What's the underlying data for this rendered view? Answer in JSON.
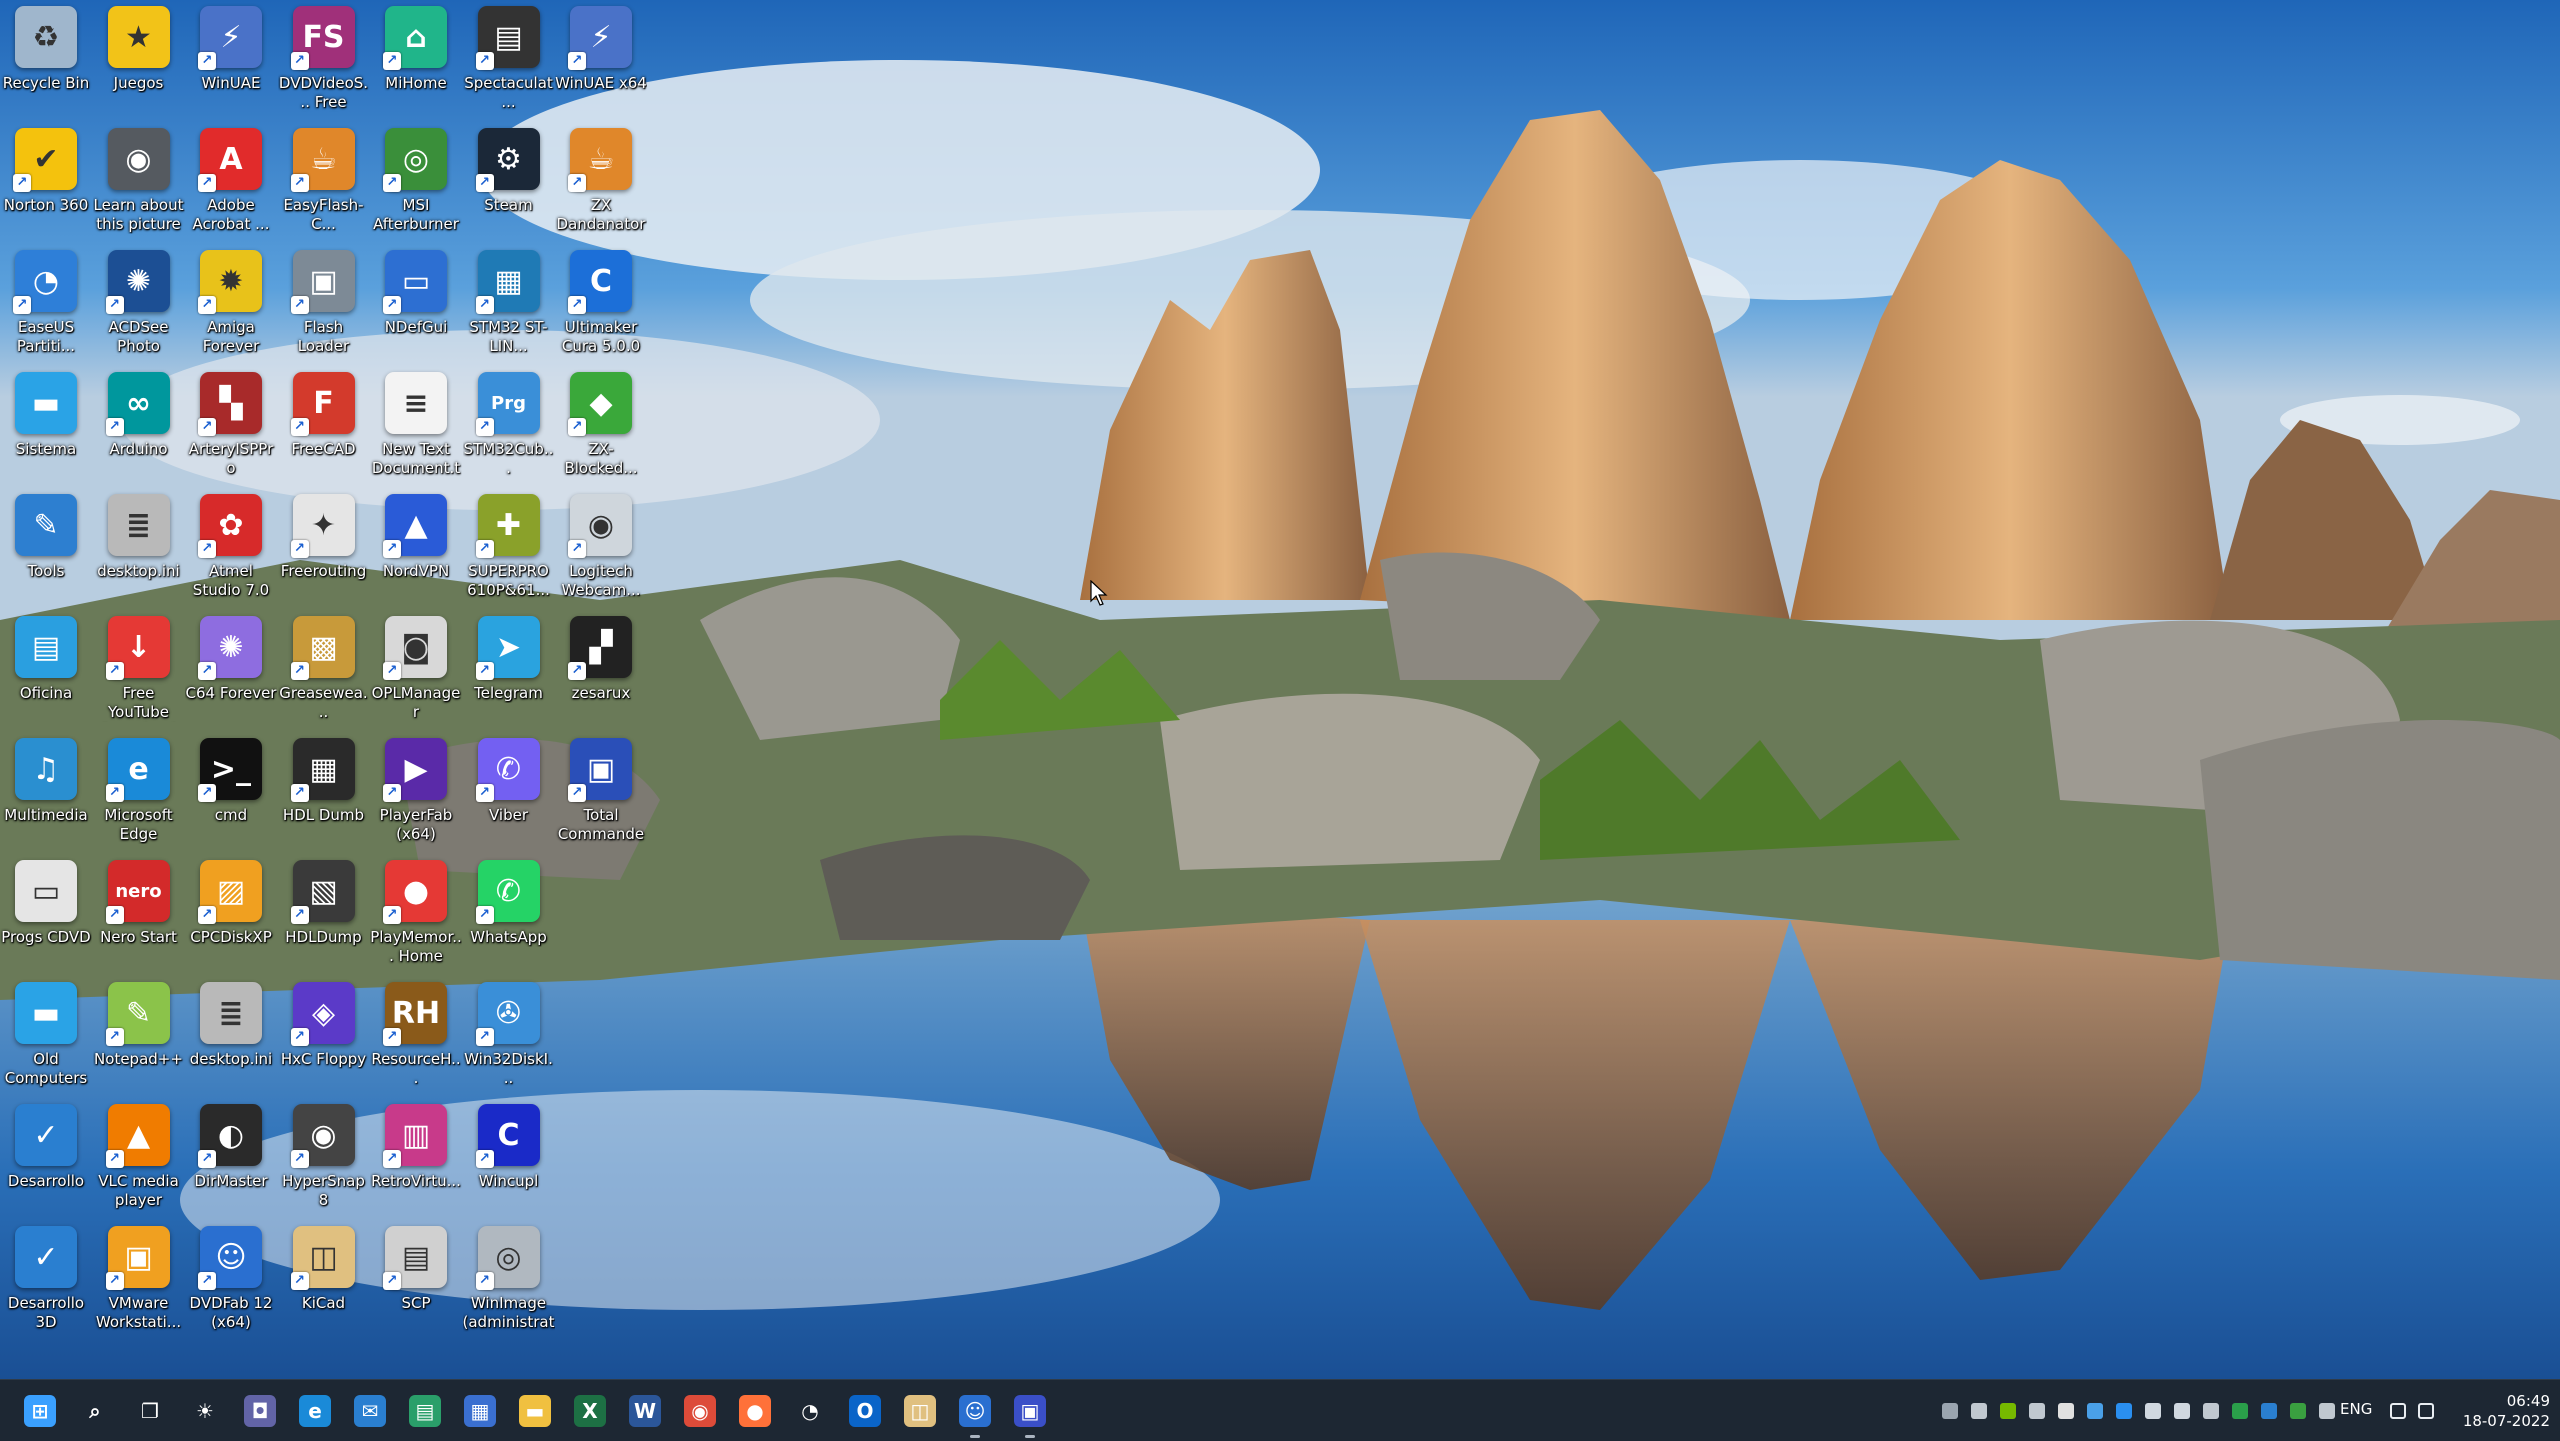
{
  "desktop": {
    "icons": [
      {
        "label": "Recycle Bin",
        "glyph": "recycle-bin-icon",
        "color": "#9fb6cc",
        "sym": "♻",
        "shortcut": false
      },
      {
        "label": "Juegos",
        "glyph": "star-folder-icon",
        "color": "#f2c318",
        "sym": "★",
        "shortcut": false
      },
      {
        "label": "WinUAE",
        "glyph": "winuae-icon",
        "color": "#4a72c8",
        "sym": "⚡",
        "shortcut": true
      },
      {
        "label": "DVDVideoS... Free Studio",
        "glyph": "free-studio-icon",
        "color": "#a0307a",
        "sym": "FS",
        "shortcut": true
      },
      {
        "label": "MiHome",
        "glyph": "mihome-icon",
        "color": "#20b58a",
        "sym": "⌂",
        "shortcut": true
      },
      {
        "label": "Spectaculat...",
        "glyph": "spectrum-keyboard-icon",
        "color": "#333333",
        "sym": "▤",
        "shortcut": true
      },
      {
        "label": "WinUAE x64",
        "glyph": "winuae-x64-icon",
        "color": "#4a72c8",
        "sym": "⚡",
        "shortcut": true
      },
      {
        "label": "Norton 360",
        "glyph": "norton-icon",
        "color": "#f4c20d",
        "sym": "✔",
        "shortcut": true
      },
      {
        "label": "Learn about this picture",
        "glyph": "camera-icon",
        "color": "#555a60",
        "sym": "◉",
        "shortcut": false
      },
      {
        "label": "Adobe Acrobat ...",
        "glyph": "acrobat-icon",
        "color": "#e12b2b",
        "sym": "A",
        "shortcut": true
      },
      {
        "label": "EasyFlash-C...",
        "glyph": "java-icon",
        "color": "#e0872a",
        "sym": "☕",
        "shortcut": true
      },
      {
        "label": "MSI Afterburner",
        "glyph": "msi-afterburner-icon",
        "color": "#3a8f3a",
        "sym": "◎",
        "shortcut": true
      },
      {
        "label": "Steam",
        "glyph": "steam-icon",
        "color": "#1b2838",
        "sym": "⚙",
        "shortcut": true
      },
      {
        "label": "ZX Dandanator",
        "glyph": "java-icon",
        "color": "#e0872a",
        "sym": "☕",
        "shortcut": true
      },
      {
        "label": "EaseUS Partiti...",
        "glyph": "easeus-icon",
        "color": "#2e7fd8",
        "sym": "◔",
        "shortcut": true
      },
      {
        "label": "ACDSee Photo Studi...",
        "glyph": "acdsee-icon",
        "color": "#1c4f94",
        "sym": "✺",
        "shortcut": true
      },
      {
        "label": "Amiga Forever",
        "glyph": "amiga-forever-icon",
        "color": "#e8c21a",
        "sym": "✹",
        "shortcut": true
      },
      {
        "label": "Flash Loader Demo",
        "glyph": "flash-loader-icon",
        "color": "#7d8a96",
        "sym": "▣",
        "shortcut": true
      },
      {
        "label": "NDefGui",
        "glyph": "ndefgui-icon",
        "color": "#2d6fd2",
        "sym": "▭",
        "shortcut": true
      },
      {
        "label": "STM32 ST-LIN...",
        "glyph": "stm32-icon",
        "color": "#1f7ab5",
        "sym": "▦",
        "shortcut": true
      },
      {
        "label": "Ultimaker Cura 5.0.0",
        "glyph": "cura-icon",
        "color": "#1c6fd8",
        "sym": "C",
        "shortcut": true
      },
      {
        "label": "Sistema",
        "glyph": "monitor-folder-icon",
        "color": "#2aa3e6",
        "sym": "▬",
        "shortcut": false
      },
      {
        "label": "Arduino",
        "glyph": "arduino-icon",
        "color": "#00979d",
        "sym": "∞",
        "shortcut": true
      },
      {
        "label": "ArteryISPPro",
        "glyph": "artery-icon",
        "color": "#a82a2a",
        "sym": "▚",
        "shortcut": true
      },
      {
        "label": "FreeCAD",
        "glyph": "freecad-icon",
        "color": "#d33a2c",
        "sym": "F",
        "shortcut": true
      },
      {
        "label": "New Text Document.txt",
        "glyph": "text-document-icon",
        "color": "#f3f3f3",
        "sym": "≡",
        "shortcut": false
      },
      {
        "label": "STM32Cub...",
        "glyph": "stm32cube-icon",
        "color": "#3a8fd8",
        "sym": "Prg",
        "shortcut": true
      },
      {
        "label": "ZX-Blocked...",
        "glyph": "zx-blocked-icon",
        "color": "#3aa83a",
        "sym": "◆",
        "shortcut": true
      },
      {
        "label": "Tools",
        "glyph": "tools-icon",
        "color": "#2d7fd0",
        "sym": "✎",
        "shortcut": false
      },
      {
        "label": "desktop.ini",
        "glyph": "ini-file-icon",
        "color": "#b9b9b9",
        "sym": "≣",
        "shortcut": false
      },
      {
        "label": "Atmel Studio 7.0",
        "glyph": "atmel-icon",
        "color": "#d72a2a",
        "sym": "✿",
        "shortcut": true
      },
      {
        "label": "Freerouting",
        "glyph": "freerouting-icon",
        "color": "#e5e5e5",
        "sym": "✦",
        "shortcut": true
      },
      {
        "label": "NordVPN",
        "glyph": "nordvpn-icon",
        "color": "#2a5bd7",
        "sym": "▲",
        "shortcut": true
      },
      {
        "label": "SUPERPRO 610P&61...",
        "glyph": "superpro-icon",
        "color": "#8aa12a",
        "sym": "✚",
        "shortcut": true
      },
      {
        "label": "Logitech Webcam...",
        "glyph": "webcam-icon",
        "color": "#cfd6dc",
        "sym": "◉",
        "shortcut": true
      },
      {
        "label": "Oficina",
        "glyph": "oficina-folder-icon",
        "color": "#2a9fe0",
        "sym": "▤",
        "shortcut": false
      },
      {
        "label": "Free YouTube Download",
        "glyph": "youtube-download-icon",
        "color": "#e53935",
        "sym": "↓",
        "shortcut": true
      },
      {
        "label": "C64 Forever",
        "glyph": "c64-forever-icon",
        "color": "#8e6de0",
        "sym": "✺",
        "shortcut": true
      },
      {
        "label": "Greasewea...",
        "glyph": "greaseweazle-icon",
        "color": "#c89a3a",
        "sym": "▩",
        "shortcut": true
      },
      {
        "label": "OPLManager",
        "glyph": "oplmanager-icon",
        "color": "#d8d8d8",
        "sym": "◙",
        "shortcut": true
      },
      {
        "label": "Telegram",
        "glyph": "telegram-icon",
        "color": "#2aa3df",
        "sym": "➤",
        "shortcut": true
      },
      {
        "label": "zesarux",
        "glyph": "zesarux-icon",
        "color": "#222222",
        "sym": "▞",
        "shortcut": true
      },
      {
        "label": "Multimedia",
        "glyph": "multimedia-folder-icon",
        "color": "#2a8fd0",
        "sym": "♫",
        "shortcut": false
      },
      {
        "label": "Microsoft Edge",
        "glyph": "edge-icon",
        "color": "#1a8ad8",
        "sym": "e",
        "shortcut": true
      },
      {
        "label": "cmd",
        "glyph": "cmd-icon",
        "color": "#111111",
        "sym": ">_",
        "shortcut": true
      },
      {
        "label": "HDL Dumb",
        "glyph": "hdl-dumb-icon",
        "color": "#2a2a2a",
        "sym": "▦",
        "shortcut": true
      },
      {
        "label": "PlayerFab (x64)",
        "glyph": "playerfab-icon",
        "color": "#5a2aa8",
        "sym": "▶",
        "shortcut": true
      },
      {
        "label": "Viber",
        "glyph": "viber-icon",
        "color": "#7360f2",
        "sym": "✆",
        "shortcut": true
      },
      {
        "label": "Total Commander",
        "glyph": "total-commander-icon",
        "color": "#2a4fb8",
        "sym": "▣",
        "shortcut": true
      },
      {
        "label": "Progs CDVD",
        "glyph": "cdvd-drive-icon",
        "color": "#e5e5e5",
        "sym": "▭",
        "shortcut": false
      },
      {
        "label": "Nero Start",
        "glyph": "nero-icon",
        "color": "#d32a2a",
        "sym": "nero",
        "shortcut": true
      },
      {
        "label": "CPCDiskXP",
        "glyph": "cpcdiskxp-icon",
        "color": "#f0a020",
        "sym": "▨",
        "shortcut": true
      },
      {
        "label": "HDLDump",
        "glyph": "hdldump-icon",
        "color": "#3a3a3a",
        "sym": "▧",
        "shortcut": true
      },
      {
        "label": "PlayMemor... Home",
        "glyph": "playmemories-icon",
        "color": "#e53935",
        "sym": "●",
        "shortcut": true
      },
      {
        "label": "WhatsApp",
        "glyph": "whatsapp-icon",
        "color": "#25d366",
        "sym": "✆",
        "shortcut": true
      },
      {
        "label": "",
        "glyph": "",
        "color": "",
        "sym": "",
        "shortcut": false
      },
      {
        "label": "Old Computers",
        "glyph": "old-computers-folder-icon",
        "color": "#2aa3e6",
        "sym": "▬",
        "shortcut": false
      },
      {
        "label": "Notepad++",
        "glyph": "notepadpp-icon",
        "color": "#8bc34a",
        "sym": "✎",
        "shortcut": true
      },
      {
        "label": "desktop.ini",
        "glyph": "ini-file-icon",
        "color": "#b9b9b9",
        "sym": "≣",
        "shortcut": false
      },
      {
        "label": "HxC Floppy",
        "glyph": "hxc-floppy-icon",
        "color": "#5b3ac8",
        "sym": "◈",
        "shortcut": true
      },
      {
        "label": "ResourceH...",
        "glyph": "resource-hacker-icon",
        "color": "#8a5a1a",
        "sym": "RH",
        "shortcut": true
      },
      {
        "label": "Win32DiskI...",
        "glyph": "win32diskimager-icon",
        "color": "#3a8fd8",
        "sym": "✇",
        "shortcut": true
      },
      {
        "label": "",
        "glyph": "",
        "color": "",
        "sym": "",
        "shortcut": false
      },
      {
        "label": "Desarrollo",
        "glyph": "desarrollo-folder-icon",
        "color": "#2a7fd0",
        "sym": "✓",
        "shortcut": false
      },
      {
        "label": "VLC media player",
        "glyph": "vlc-icon",
        "color": "#f07c00",
        "sym": "▲",
        "shortcut": true
      },
      {
        "label": "DirMaster",
        "glyph": "dirmaster-icon",
        "color": "#2a2a2a",
        "sym": "◐",
        "shortcut": true
      },
      {
        "label": "HyperSnap 8",
        "glyph": "hypersnap-icon",
        "color": "#444444",
        "sym": "◉",
        "shortcut": true
      },
      {
        "label": "RetroVirtu...",
        "glyph": "retrovirtual-icon",
        "color": "#c83a8a",
        "sym": "▥",
        "shortcut": true
      },
      {
        "label": "Wincupl",
        "glyph": "wincupl-icon",
        "color": "#1a2ac8",
        "sym": "C",
        "shortcut": true
      },
      {
        "label": "",
        "glyph": "",
        "color": "",
        "sym": "",
        "shortcut": false
      },
      {
        "label": "Desarrollo 3D",
        "glyph": "desarrollo-3d-folder-icon",
        "color": "#2a7fd0",
        "sym": "✓",
        "shortcut": false
      },
      {
        "label": "VMware Workstati...",
        "glyph": "vmware-icon",
        "color": "#f0a020",
        "sym": "▣",
        "shortcut": true
      },
      {
        "label": "DVDFab 12 (x64)",
        "glyph": "dvdfab-icon",
        "color": "#2a6fd0",
        "sym": "☺",
        "shortcut": true
      },
      {
        "label": "KiCad",
        "glyph": "kicad-icon",
        "color": "#e0c080",
        "sym": "◫",
        "shortcut": true
      },
      {
        "label": "SCP",
        "glyph": "scp-icon",
        "color": "#d0d0d0",
        "sym": "▤",
        "shortcut": true
      },
      {
        "label": "WinImage (administrat...",
        "glyph": "winimage-icon",
        "color": "#b0b8c0",
        "sym": "◎",
        "shortcut": true
      },
      {
        "label": "",
        "glyph": "",
        "color": "",
        "sym": "",
        "shortcut": false
      }
    ]
  },
  "taskbar": {
    "items": [
      {
        "name": "start-icon",
        "color": "#3aa0ff",
        "sym": "⊞",
        "running": false
      },
      {
        "name": "search-icon",
        "color": "transparent",
        "sym": "⌕",
        "running": false
      },
      {
        "name": "task-view-icon",
        "color": "transparent",
        "sym": "❐",
        "running": false
      },
      {
        "name": "weather-icon",
        "color": "transparent",
        "sym": "☀",
        "running": false
      },
      {
        "name": "teams-chat-icon",
        "color": "#6264a7",
        "sym": "◘",
        "running": false
      },
      {
        "name": "edge-icon",
        "color": "#1a8ad8",
        "sym": "e",
        "running": false
      },
      {
        "name": "mail-icon",
        "color": "#2a7fd0",
        "sym": "✉",
        "running": false
      },
      {
        "name": "remote-desktop-icon",
        "color": "#2a9f6a",
        "sym": "▤",
        "running": false
      },
      {
        "name": "hardware-manager-icon",
        "color": "#3a6fd0",
        "sym": "▦",
        "running": false
      },
      {
        "name": "file-explorer-icon",
        "color": "#f0c040",
        "sym": "▬",
        "running": false
      },
      {
        "name": "excel-icon",
        "color": "#1d7044",
        "sym": "X",
        "running": false
      },
      {
        "name": "word-icon",
        "color": "#2b5699",
        "sym": "W",
        "running": false
      },
      {
        "name": "chrome-icon",
        "color": "#dd4b39",
        "sym": "◉",
        "running": false
      },
      {
        "name": "firefox-icon",
        "color": "#ff7139",
        "sym": "●",
        "running": false
      },
      {
        "name": "media-player-icon",
        "color": "transparent",
        "sym": "◔",
        "running": false
      },
      {
        "name": "outlook-icon",
        "color": "#0a64c8",
        "sym": "O",
        "running": false
      },
      {
        "name": "kicad-icon",
        "color": "#e0c080",
        "sym": "◫",
        "running": false
      },
      {
        "name": "dvdfab-icon",
        "color": "#2a6fd0",
        "sym": "☺",
        "running": true
      },
      {
        "name": "floppy-app-icon",
        "color": "#3a4fc8",
        "sym": "▣",
        "running": true
      }
    ],
    "tray": [
      {
        "name": "tray-record-icon",
        "color": "#9aa5b0"
      },
      {
        "name": "tray-audio-app-icon",
        "color": "#c0c8d0"
      },
      {
        "name": "tray-nvidia-icon",
        "color": "#76b900"
      },
      {
        "name": "tray-window-icon",
        "color": "#c0c8d0"
      },
      {
        "name": "tray-cd-icon",
        "color": "#e0e0e0"
      },
      {
        "name": "tray-onedrive-icon",
        "color": "#4aa0e8"
      },
      {
        "name": "tray-dropbox-icon",
        "color": "#2a8ff0"
      },
      {
        "name": "tray-webcam-icon",
        "color": "#d0d8e0"
      },
      {
        "name": "tray-camera-icon",
        "color": "#d0d8e0"
      },
      {
        "name": "tray-usb-icon",
        "color": "#c0c8d0"
      },
      {
        "name": "tray-norton-icon",
        "color": "#2a9f4a"
      },
      {
        "name": "tray-defender-icon",
        "color": "#2a7fd0"
      },
      {
        "name": "tray-security-icon",
        "color": "#3aa040"
      },
      {
        "name": "tray-arrow-icon",
        "color": "#c0c8d0"
      }
    ],
    "language": "ENG",
    "time": "06:49",
    "date": "18-07-2022"
  }
}
